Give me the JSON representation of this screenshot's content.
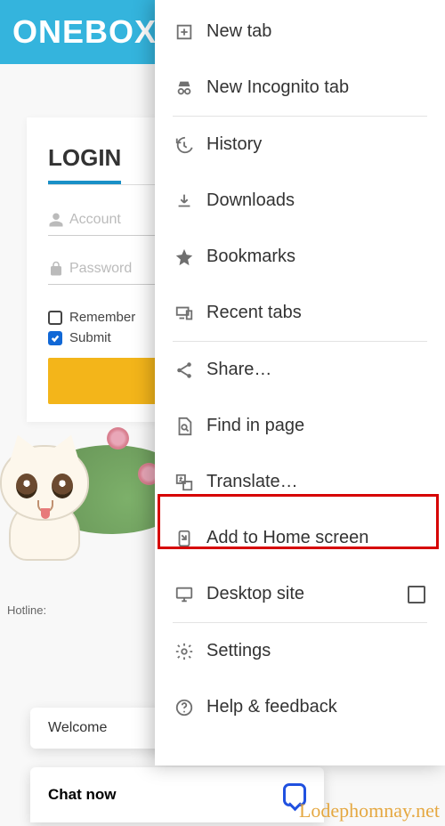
{
  "header": {
    "title": "ONEBOX"
  },
  "login": {
    "title": "LOGIN",
    "account_placeholder": "Account",
    "password_placeholder": "Password",
    "remember_label": "Remember",
    "submit_label": "Submit"
  },
  "hotline_label": "Hotline:",
  "welcome_text": "Welcome",
  "chat_label": "Chat now",
  "watermark": "Lodephomnay.net",
  "menu": {
    "items": [
      {
        "label": "New tab",
        "icon": "plus"
      },
      {
        "label": "New Incognito tab",
        "icon": "incognito"
      },
      {
        "label": "History",
        "icon": "history"
      },
      {
        "label": "Downloads",
        "icon": "download"
      },
      {
        "label": "Bookmarks",
        "icon": "star"
      },
      {
        "label": "Recent tabs",
        "icon": "devices"
      },
      {
        "label": "Share…",
        "icon": "share"
      },
      {
        "label": "Find in page",
        "icon": "find"
      },
      {
        "label": "Translate…",
        "icon": "translate"
      },
      {
        "label": "Add to Home screen",
        "icon": "add-home"
      },
      {
        "label": "Desktop site",
        "icon": "desktop"
      },
      {
        "label": "Settings",
        "icon": "gear"
      },
      {
        "label": "Help & feedback",
        "icon": "help"
      }
    ]
  }
}
